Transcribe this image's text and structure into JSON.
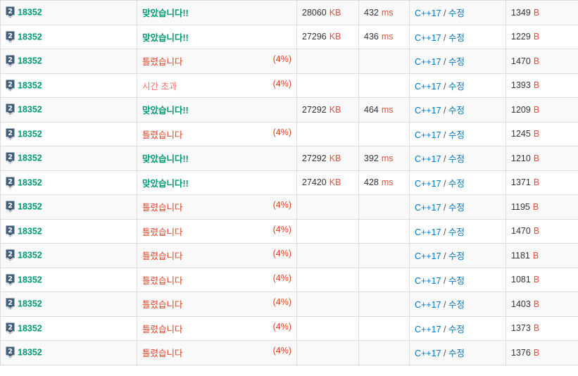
{
  "colors": {
    "accepted": "#009874",
    "wrong": "#dd4124",
    "time_limit": "#fa7268",
    "link": "#0076c0",
    "unit": "#e74c3c",
    "tier_badge": "#435f7a"
  },
  "labels": {
    "memory_unit": "KB",
    "time_unit": "ms",
    "length_unit": "B",
    "separator": "/",
    "edit": "수정"
  },
  "tier_icon": "silver-2-tier-icon",
  "rows": [
    {
      "problem": "18352",
      "tier": "2",
      "result": "맞았습니다!!",
      "result_type": "ac",
      "percent": "",
      "memory": "28060",
      "time": "432",
      "lang": "C++17",
      "length": "1349"
    },
    {
      "problem": "18352",
      "tier": "2",
      "result": "맞았습니다!!",
      "result_type": "ac",
      "percent": "",
      "memory": "27296",
      "time": "436",
      "lang": "C++17",
      "length": "1229"
    },
    {
      "problem": "18352",
      "tier": "2",
      "result": "틀렸습니다",
      "result_type": "wa",
      "percent": "(4%)",
      "memory": "",
      "time": "",
      "lang": "C++17",
      "length": "1470"
    },
    {
      "problem": "18352",
      "tier": "2",
      "result": "시간 초과",
      "result_type": "tle",
      "percent": "(4%)",
      "memory": "",
      "time": "",
      "lang": "C++17",
      "length": "1393"
    },
    {
      "problem": "18352",
      "tier": "2",
      "result": "맞았습니다!!",
      "result_type": "ac",
      "percent": "",
      "memory": "27292",
      "time": "464",
      "lang": "C++17",
      "length": "1209"
    },
    {
      "problem": "18352",
      "tier": "2",
      "result": "틀렸습니다",
      "result_type": "wa",
      "percent": "(4%)",
      "memory": "",
      "time": "",
      "lang": "C++17",
      "length": "1245"
    },
    {
      "problem": "18352",
      "tier": "2",
      "result": "맞았습니다!!",
      "result_type": "ac",
      "percent": "",
      "memory": "27292",
      "time": "392",
      "lang": "C++17",
      "length": "1210"
    },
    {
      "problem": "18352",
      "tier": "2",
      "result": "맞았습니다!!",
      "result_type": "ac",
      "percent": "",
      "memory": "27420",
      "time": "428",
      "lang": "C++17",
      "length": "1371"
    },
    {
      "problem": "18352",
      "tier": "2",
      "result": "틀렸습니다",
      "result_type": "wa",
      "percent": "(4%)",
      "memory": "",
      "time": "",
      "lang": "C++17",
      "length": "1195"
    },
    {
      "problem": "18352",
      "tier": "2",
      "result": "틀렸습니다",
      "result_type": "wa",
      "percent": "(4%)",
      "memory": "",
      "time": "",
      "lang": "C++17",
      "length": "1470"
    },
    {
      "problem": "18352",
      "tier": "2",
      "result": "틀렸습니다",
      "result_type": "wa",
      "percent": "(4%)",
      "memory": "",
      "time": "",
      "lang": "C++17",
      "length": "1181"
    },
    {
      "problem": "18352",
      "tier": "2",
      "result": "틀렸습니다",
      "result_type": "wa",
      "percent": "(4%)",
      "memory": "",
      "time": "",
      "lang": "C++17",
      "length": "1081"
    },
    {
      "problem": "18352",
      "tier": "2",
      "result": "틀렸습니다",
      "result_type": "wa",
      "percent": "(4%)",
      "memory": "",
      "time": "",
      "lang": "C++17",
      "length": "1403"
    },
    {
      "problem": "18352",
      "tier": "2",
      "result": "틀렸습니다",
      "result_type": "wa",
      "percent": "(4%)",
      "memory": "",
      "time": "",
      "lang": "C++17",
      "length": "1373"
    },
    {
      "problem": "18352",
      "tier": "2",
      "result": "틀렸습니다",
      "result_type": "wa",
      "percent": "(4%)",
      "memory": "",
      "time": "",
      "lang": "C++17",
      "length": "1376"
    }
  ]
}
